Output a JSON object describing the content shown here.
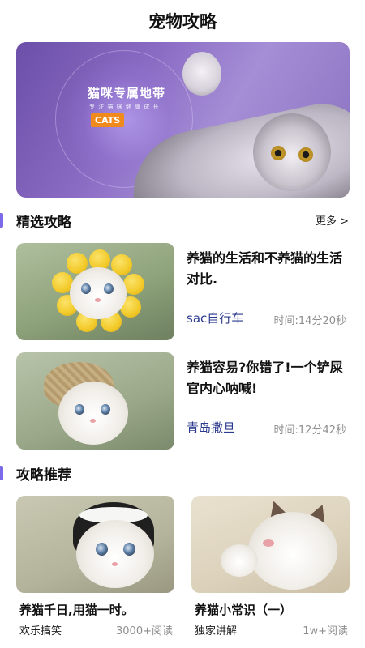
{
  "header": {
    "title": "宠物攻略"
  },
  "banner": {
    "headline": "猫咪专属地带",
    "subtext": "专 注 猫 咪 健 康 成 长",
    "tag": "CATS"
  },
  "featured": {
    "title": "精选攻略",
    "more_label": "更多 >",
    "articles": [
      {
        "headline": "养猫的生活和不养猫的生活对比.",
        "author": "sac自行车",
        "time": "时间:14分20秒"
      },
      {
        "headline": "养猫容易?你错了!一个铲屎官内心呐喊!",
        "author": "青岛撒旦",
        "time": "时间:12分42秒"
      }
    ]
  },
  "recommend": {
    "title": "攻略推荐",
    "cards": [
      {
        "title": "养猫千日,用猫一时。",
        "tag": "欢乐搞笑",
        "reads": "3000+阅读"
      },
      {
        "title": "养猫小常识（一）",
        "tag": "独家讲解",
        "reads": "1w+阅读"
      }
    ]
  },
  "colors": {
    "accent": "#7c6be8",
    "author": "#2b3a8f",
    "muted": "#8e8e8e",
    "banner": "#8b6cc4"
  }
}
